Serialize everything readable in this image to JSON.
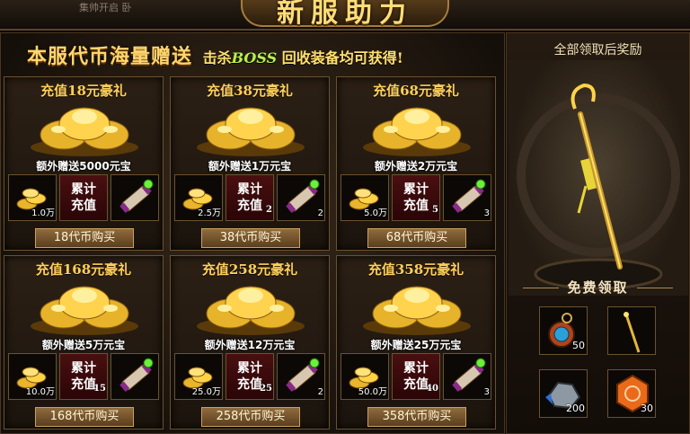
{
  "header": {
    "top_left_text": "集帅开启 卧",
    "title": "新服助力"
  },
  "slogan": {
    "main": "本服代币海量赠送",
    "sub_prefix": "击杀",
    "sub_boss": "BOSS",
    "sub_suffix": " 回收装备均可获得!"
  },
  "accum_label_top": "累计",
  "accum_label_bottom": "充值",
  "packs": [
    {
      "title": "充值18元豪礼",
      "bonus": "额外赠送5000元宝",
      "gold_qty": "1.0万",
      "accum_qty": "",
      "scroll_qty": "",
      "button": "18代币购买"
    },
    {
      "title": "充值38元豪礼",
      "bonus": "额外赠送1万元宝",
      "gold_qty": "2.5万",
      "accum_qty": "2",
      "scroll_qty": "2",
      "button": "38代币购买"
    },
    {
      "title": "充值68元豪礼",
      "bonus": "额外赠送2万元宝",
      "gold_qty": "5.0万",
      "accum_qty": "5",
      "scroll_qty": "3",
      "button": "68代币购买"
    },
    {
      "title": "充值168元豪礼",
      "bonus": "额外赠送5万元宝",
      "gold_qty": "10.0万",
      "accum_qty": "15",
      "scroll_qty": "",
      "button": "168代币购买"
    },
    {
      "title": "充值258元豪礼",
      "bonus": "额外赠送12万元宝",
      "gold_qty": "25.0万",
      "accum_qty": "25",
      "scroll_qty": "2",
      "button": "258代币购买"
    },
    {
      "title": "充值358元豪礼",
      "bonus": "额外赠送25万元宝",
      "gold_qty": "50.0万",
      "accum_qty": "40",
      "scroll_qty": "3",
      "button": "358代币购买"
    }
  ],
  "right_panel": {
    "header": "全部领取后奖励",
    "free_title": "免费领取",
    "rewards": [
      {
        "icon": "compass-amulet-icon",
        "qty": "50"
      },
      {
        "icon": "golden-staff-icon",
        "qty": ""
      },
      {
        "icon": "ore-stone-icon",
        "qty": "200"
      },
      {
        "icon": "orange-emblem-icon",
        "qty": "30"
      }
    ]
  },
  "colors": {
    "accent_gold": "#ffcf5a",
    "boss_green": "#b6f04a",
    "accum_red": "#4a0f10"
  }
}
